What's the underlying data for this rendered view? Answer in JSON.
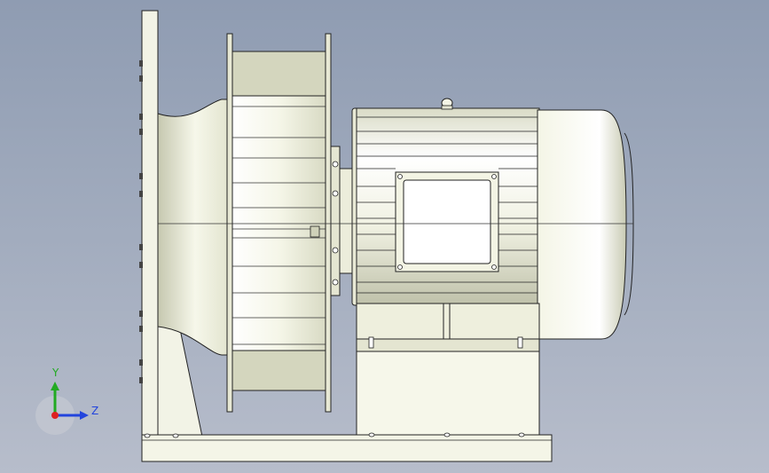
{
  "viewport": {
    "background_top": "#8f9cb2",
    "background_bottom": "#b7bdcb"
  },
  "model": {
    "description_icon": "centrifugal-fan-motor-assembly",
    "part_color": "#e9ead6",
    "edge_color": "#1a1a1a"
  },
  "triad": {
    "y_label": "Y",
    "z_label": "Z",
    "y_color": "#22aa22",
    "z_color": "#2244dd",
    "origin_color": "#dd2222"
  }
}
